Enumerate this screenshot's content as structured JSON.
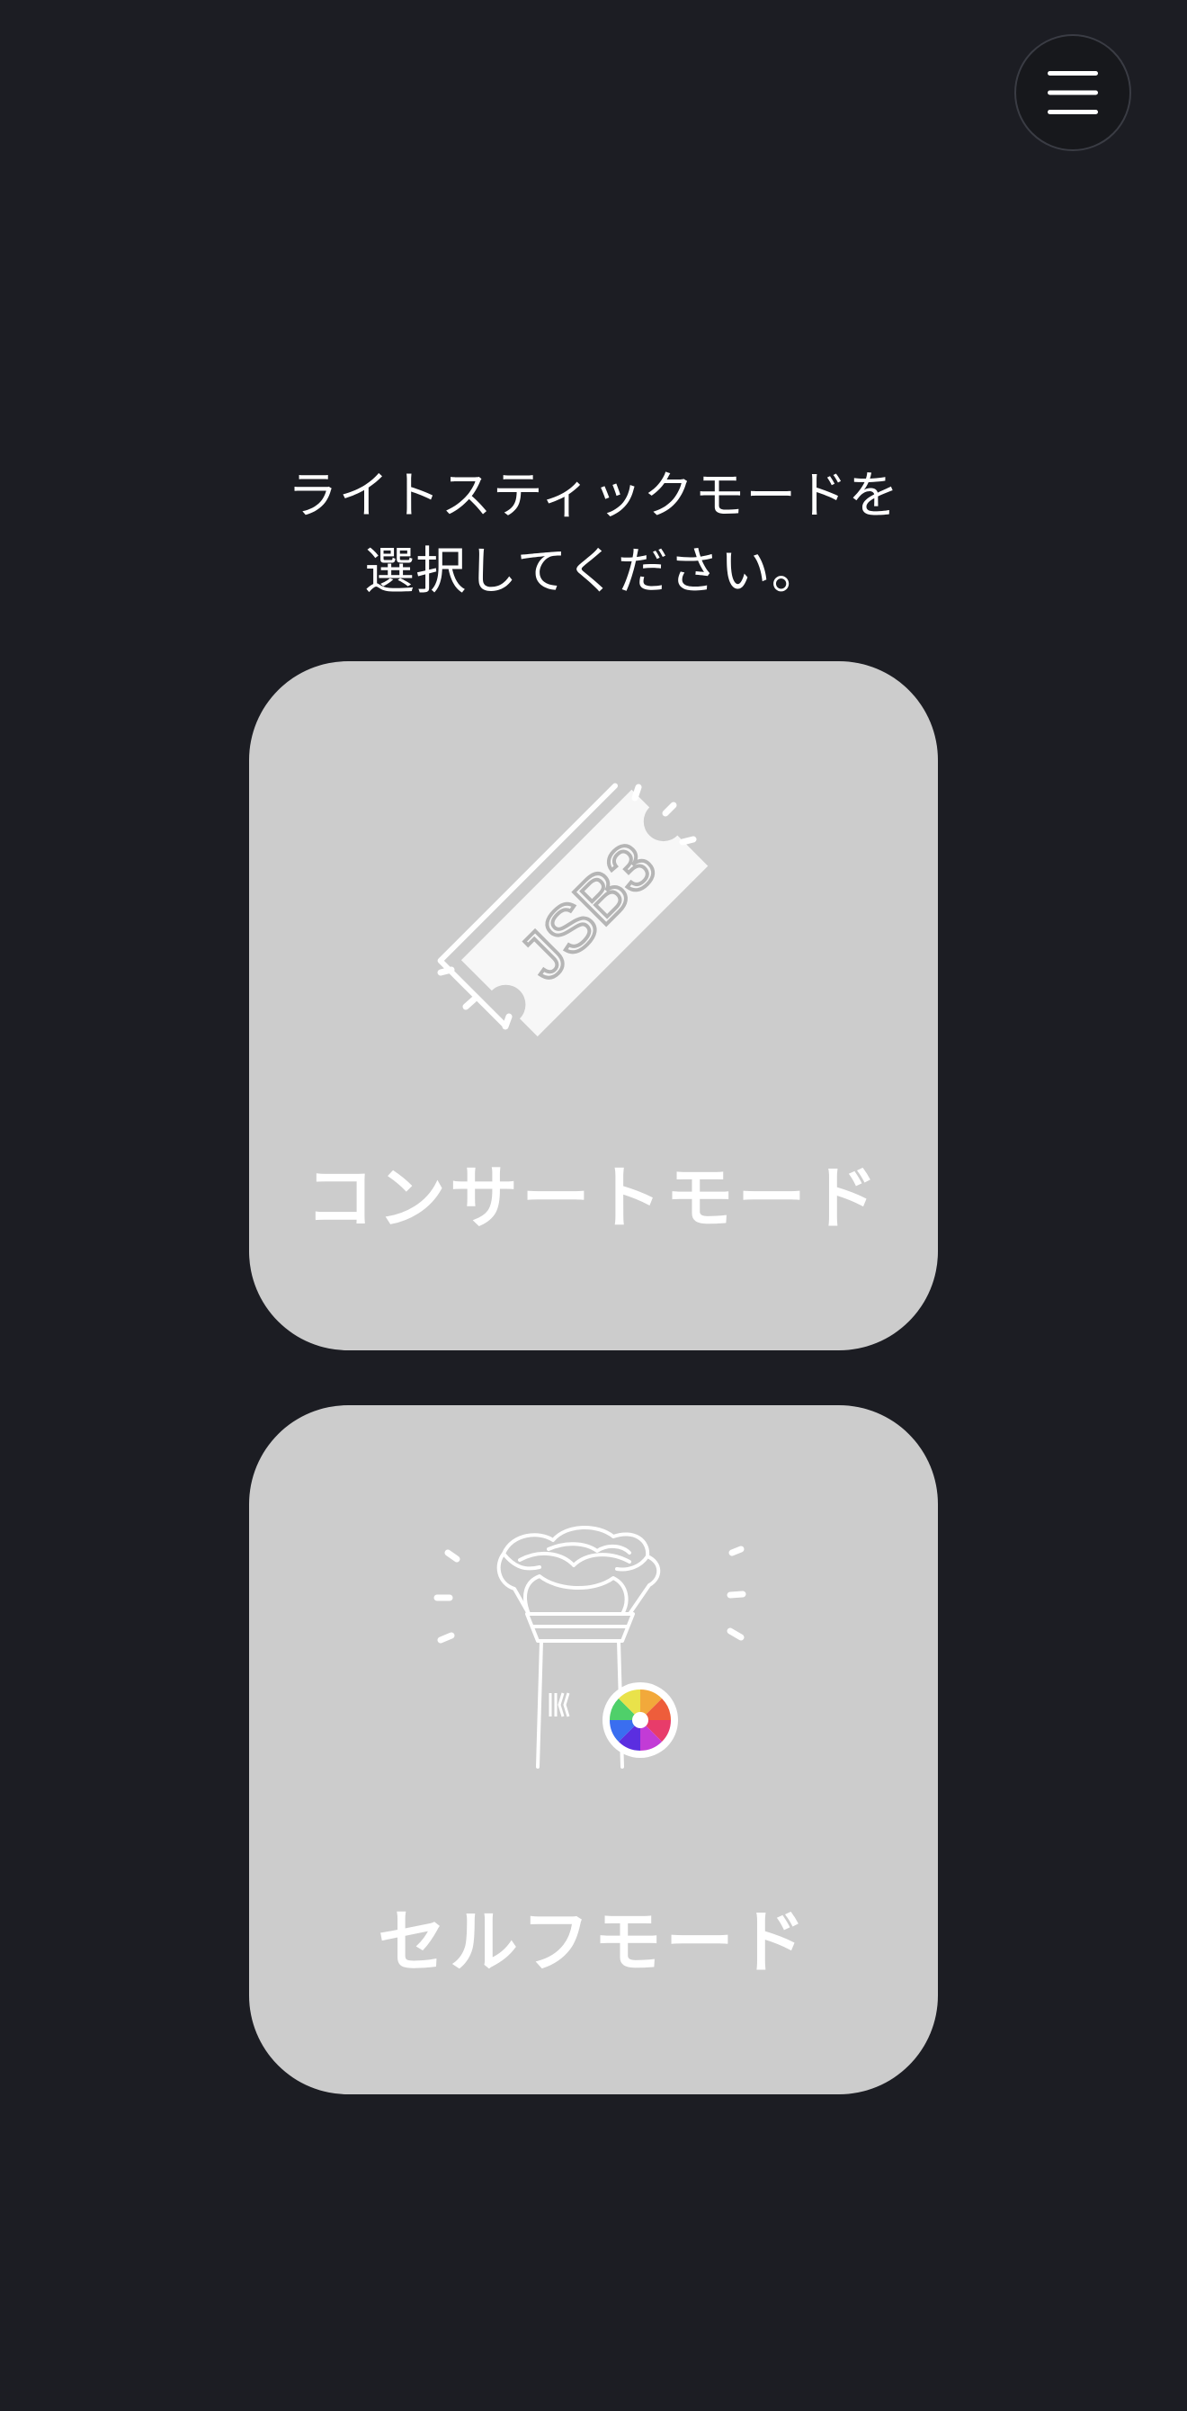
{
  "header": {
    "menu_icon": "hamburger-menu-icon"
  },
  "prompt": {
    "line1": "ライトスティックモードを",
    "line2": "選択してください。"
  },
  "modes": [
    {
      "label": "コンサートモード",
      "icon": "concert-ticket-icon",
      "ticket_text": "JSB3"
    },
    {
      "label": "セルフモード",
      "icon": "lightstick-color-wheel-icon"
    }
  ],
  "colors": {
    "background": "#1c1d23",
    "card": "#cccccc",
    "text": "#ffffff"
  }
}
